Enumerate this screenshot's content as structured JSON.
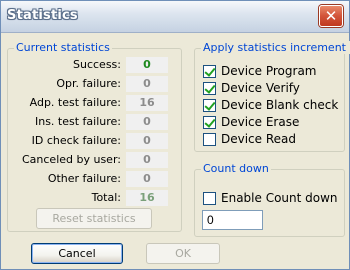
{
  "window": {
    "title": "Statistics"
  },
  "stats": {
    "legend": "Current statistics",
    "rows": [
      {
        "label": "Success:",
        "value": "0",
        "kind": "success"
      },
      {
        "label": "Opr. failure:",
        "value": "0",
        "kind": "normal"
      },
      {
        "label": "Adp. test failure:",
        "value": "16",
        "kind": "normal"
      },
      {
        "label": "Ins. test failure:",
        "value": "0",
        "kind": "normal"
      },
      {
        "label": "ID check failure:",
        "value": "0",
        "kind": "normal"
      },
      {
        "label": "Canceled by user:",
        "value": "0",
        "kind": "normal"
      },
      {
        "label": "Other failure:",
        "value": "0",
        "kind": "normal"
      },
      {
        "label": "Total:",
        "value": "16",
        "kind": "total"
      }
    ],
    "reset_label": "Reset statistics"
  },
  "apply": {
    "legend": "Apply statistics increment on",
    "options": [
      {
        "label": "Device Program",
        "checked": true
      },
      {
        "label": "Device Verify",
        "checked": true
      },
      {
        "label": "Device Blank check",
        "checked": true
      },
      {
        "label": "Device Erase",
        "checked": true
      },
      {
        "label": "Device Read",
        "checked": false
      }
    ]
  },
  "countdown": {
    "legend": "Count down",
    "enable_label": "Enable Count down",
    "enable_checked": false,
    "value": "0"
  },
  "buttons": {
    "cancel": "Cancel",
    "ok": "OK"
  },
  "colors": {
    "success": "#1e8a1e",
    "accent": "#0046d5",
    "check": "#21a121"
  }
}
